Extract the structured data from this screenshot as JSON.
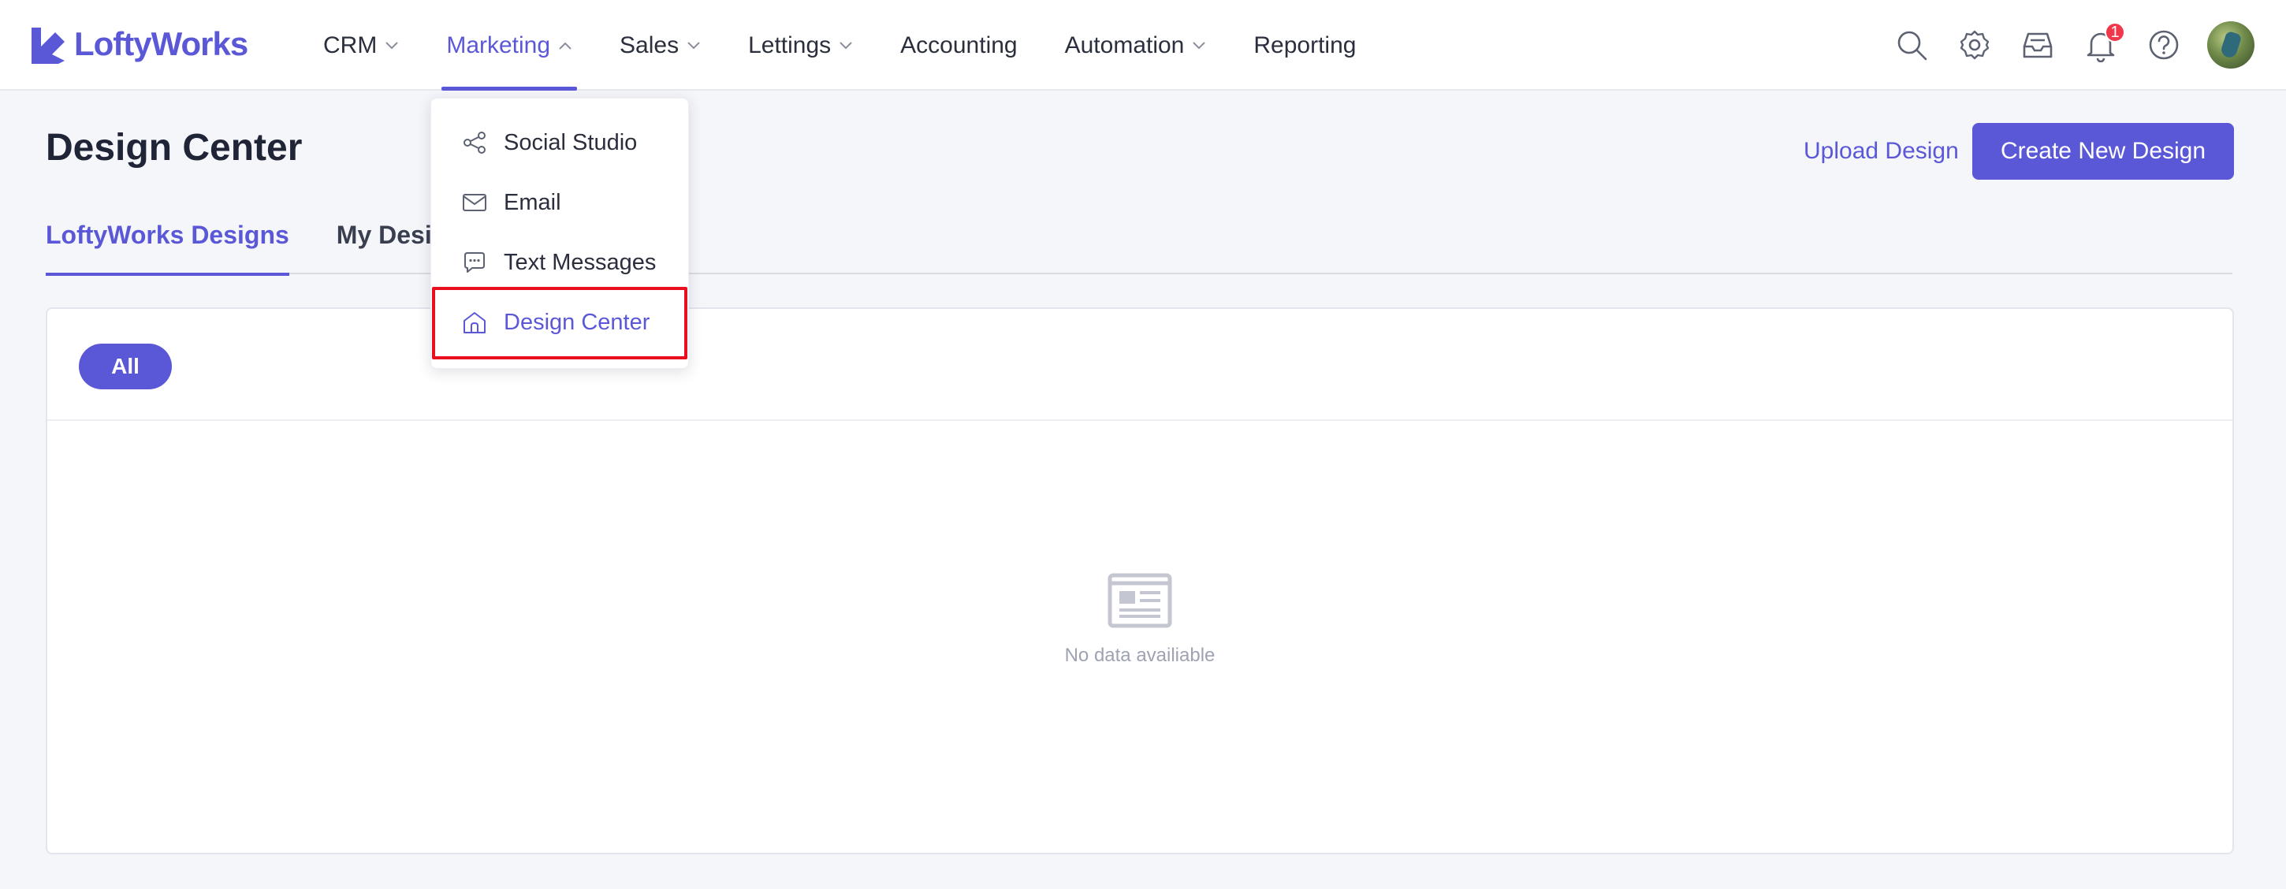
{
  "app": {
    "logo_text": "LoftyWorks"
  },
  "nav": {
    "items": [
      {
        "label": "CRM",
        "has_chevron": true
      },
      {
        "label": "Marketing",
        "has_chevron": true,
        "active": true
      },
      {
        "label": "Sales",
        "has_chevron": true
      },
      {
        "label": "Lettings",
        "has_chevron": true
      },
      {
        "label": "Accounting",
        "has_chevron": false
      },
      {
        "label": "Automation",
        "has_chevron": true
      },
      {
        "label": "Reporting",
        "has_chevron": false
      }
    ]
  },
  "header_icons": {
    "icons": [
      "search-icon",
      "gear-icon",
      "inbox-icon",
      "bell-icon",
      "help-icon"
    ],
    "notification_count": "1"
  },
  "marketing_menu": {
    "items": [
      {
        "label": "Social Studio",
        "icon": "share-icon"
      },
      {
        "label": "Email",
        "icon": "mail-icon"
      },
      {
        "label": "Text Messages",
        "icon": "chat-icon"
      },
      {
        "label": "Design Center",
        "icon": "home-icon",
        "current": true
      }
    ]
  },
  "page": {
    "title": "Design Center",
    "upload_label": "Upload Design",
    "create_label": "Create New Design",
    "tabs": [
      {
        "label": "LoftyWorks Designs",
        "active": true
      },
      {
        "label": "My Designs"
      }
    ],
    "filter_all": "All",
    "empty_text": "No data availiable"
  },
  "colors": {
    "accent": "#5b58d8",
    "highlight": "#e8101e",
    "badge": "#f0384a"
  }
}
